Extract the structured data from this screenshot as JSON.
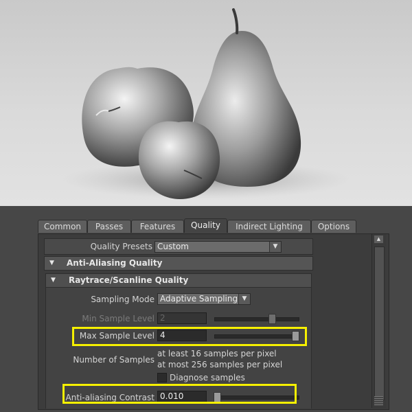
{
  "tabs": [
    "Common",
    "Passes",
    "Features",
    "Quality",
    "Indirect Lighting",
    "Options"
  ],
  "active_tab": "Quality",
  "quality_presets": {
    "label": "Quality Presets",
    "value": "Custom"
  },
  "sections": {
    "anti_aliasing": "Anti-Aliasing Quality",
    "raytrace": "Raytrace/Scanline Quality"
  },
  "sampling_mode": {
    "label": "Sampling Mode",
    "value": "Adaptive Sampling"
  },
  "min_sample_level": {
    "label": "Min Sample Level",
    "value": "2"
  },
  "max_sample_level": {
    "label": "Max Sample Level",
    "value": "4"
  },
  "number_of_samples": {
    "label": "Number of Samples",
    "line1": "at least 16 samples per pixel",
    "line2": "at most 256 samples per pixel"
  },
  "diagnose_samples": {
    "label": "Diagnose samples",
    "checked": false
  },
  "anti_aliasing_contrast": {
    "label": "Anti-aliasing Contrast",
    "value": "0.010"
  },
  "icons": {
    "dropdown": "chevron-down-icon",
    "section": "triangle-down-icon",
    "scroll_up": "arrow-up-icon"
  },
  "colors": {
    "highlight": "#f6f000",
    "panel": "#474747"
  }
}
